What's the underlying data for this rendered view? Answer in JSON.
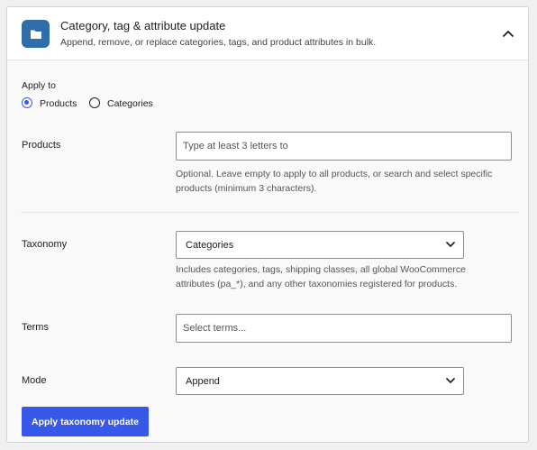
{
  "header": {
    "title": "Category, tag & attribute update",
    "subtitle": "Append, remove, or replace categories, tags, and product attributes in bulk.",
    "icon": "folder-icon",
    "collapse_icon": "chevron-up-icon"
  },
  "apply_to": {
    "label": "Apply to",
    "options": [
      {
        "label": "Products",
        "selected": true
      },
      {
        "label": "Categories",
        "selected": false
      }
    ]
  },
  "products": {
    "label": "Products",
    "placeholder": "Type at least 3 letters to",
    "help": "Optional. Leave empty to apply to all products, or search and select specific products (minimum 3 characters)."
  },
  "taxonomy": {
    "label": "Taxonomy",
    "value": "Categories",
    "help": "Includes categories, tags, shipping classes, all global WooCommerce attributes (pa_*), and any other taxonomies registered for products."
  },
  "terms": {
    "label": "Terms",
    "placeholder": "Select terms..."
  },
  "mode": {
    "label": "Mode",
    "value": "Append"
  },
  "submit": {
    "label": "Apply taxonomy update"
  },
  "colors": {
    "accent": "#3858e9",
    "icon_bg": "#2f6ea9",
    "body_bg": "#f9f9f9"
  }
}
